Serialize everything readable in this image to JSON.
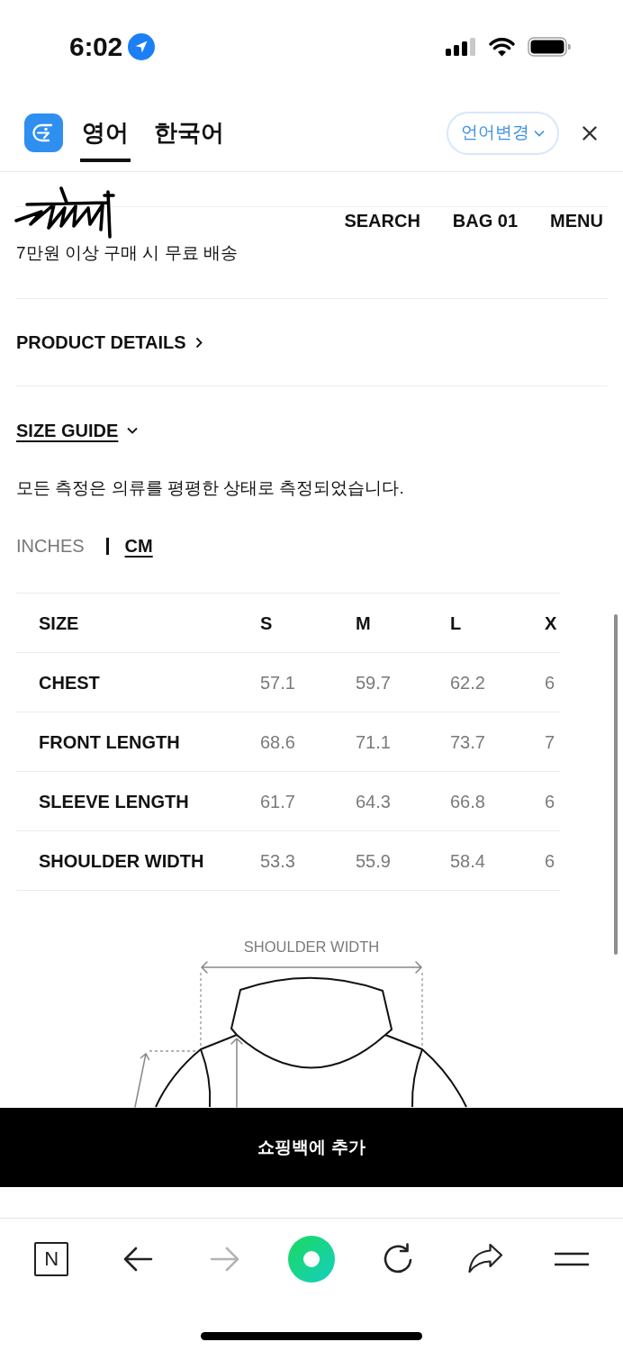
{
  "status_bar": {
    "time": "6:02"
  },
  "translate_bar": {
    "tabs": [
      {
        "label": "영어",
        "selected": true
      },
      {
        "label": "한국어",
        "selected": false
      }
    ],
    "language_button": "언어변경"
  },
  "site_header": {
    "nav": [
      "SEARCH",
      "BAG 01",
      "MENU"
    ],
    "shipping_note": "7만원 이상 구매 시 무료 배송"
  },
  "sections": [
    {
      "label": "PRODUCT DETAILS",
      "expanded": false
    },
    {
      "label": "SIZE GUIDE",
      "expanded": true
    }
  ],
  "size_guide": {
    "note": "모든 측정은 의류를 평평한 상태로 측정되었습니다.",
    "units": [
      {
        "label": "INCHES",
        "selected": false
      },
      {
        "label": "CM",
        "selected": true
      }
    ],
    "table": {
      "columns": [
        "SIZE",
        "S",
        "M",
        "L",
        "X"
      ],
      "rows": [
        [
          "CHEST",
          "57.1",
          "59.7",
          "62.2",
          "6"
        ],
        [
          "FRONT LENGTH",
          "68.6",
          "71.1",
          "73.7",
          "7"
        ],
        [
          "SLEEVE LENGTH",
          "61.7",
          "64.3",
          "66.8",
          "6"
        ],
        [
          "SHOULDER WIDTH",
          "53.3",
          "55.9",
          "58.4",
          "6"
        ]
      ]
    },
    "diagram_label": "SHOULDER WIDTH"
  },
  "add_button": "쇼핑백에 추가",
  "browser_toolbar": {
    "buttons": [
      {
        "kind": "letter",
        "label": "N",
        "disabled": false
      },
      {
        "kind": "back",
        "disabled": false
      },
      {
        "kind": "forward",
        "disabled": true
      },
      {
        "kind": "ring",
        "disabled": false
      },
      {
        "kind": "reload",
        "disabled": false
      },
      {
        "kind": "share",
        "disabled": false
      },
      {
        "kind": "menu",
        "disabled": false
      }
    ]
  }
}
